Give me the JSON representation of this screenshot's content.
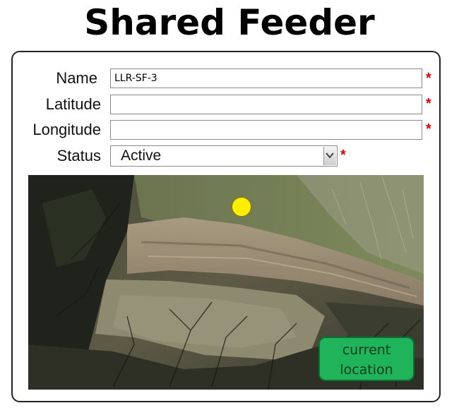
{
  "page": {
    "title": "Shared Feeder"
  },
  "form": {
    "name": {
      "label": "Name",
      "value": "LLR-SF-3",
      "required_mark": "*"
    },
    "latitude": {
      "label": "Latitude",
      "value": "",
      "required_mark": "*"
    },
    "longitude": {
      "label": "Longitude",
      "value": "",
      "required_mark": "*"
    },
    "status": {
      "label": "Status",
      "value": "Active",
      "required_mark": "*"
    }
  },
  "map": {
    "marker_color": "#ffee00",
    "current_location_button": {
      "line1": "current",
      "line2": "location",
      "color": "#1fb45a"
    }
  }
}
